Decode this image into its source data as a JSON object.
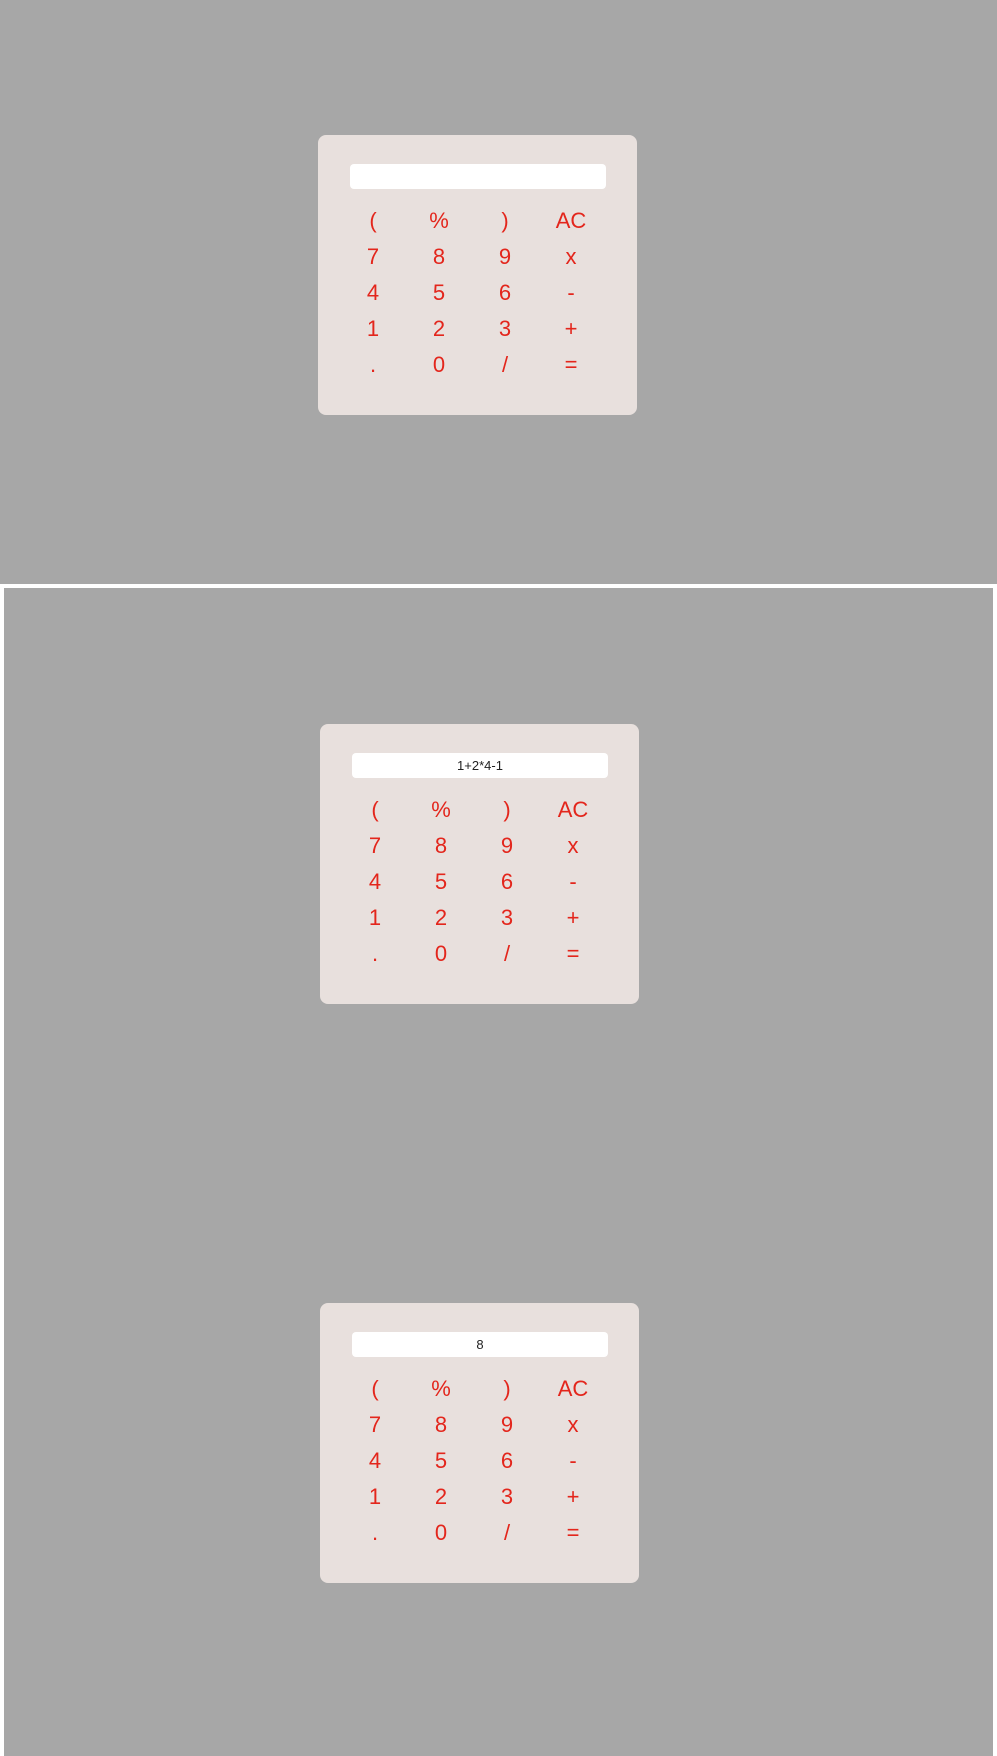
{
  "accent_color": "#e3261c",
  "states": [
    {
      "display": ""
    },
    {
      "display": "1+2*4-1"
    },
    {
      "display": "8"
    }
  ],
  "keys": [
    {
      "label": "(",
      "icon": null
    },
    {
      "label": "%",
      "icon": null
    },
    {
      "label": ")",
      "icon": null
    },
    {
      "label": "AC",
      "icon": null
    },
    {
      "label": "7",
      "icon": null
    },
    {
      "label": "8",
      "icon": null
    },
    {
      "label": "9",
      "icon": null
    },
    {
      "label": "x",
      "icon": null
    },
    {
      "label": "4",
      "icon": null
    },
    {
      "label": "5",
      "icon": null
    },
    {
      "label": "6",
      "icon": null
    },
    {
      "label": "-",
      "icon": null
    },
    {
      "label": "1",
      "icon": null
    },
    {
      "label": "2",
      "icon": null
    },
    {
      "label": "3",
      "icon": null
    },
    {
      "label": "+",
      "icon": null
    },
    {
      "label": ".",
      "icon": null
    },
    {
      "label": "0",
      "icon": null
    },
    {
      "label": "/",
      "icon": null
    },
    {
      "label": "=",
      "icon": null
    }
  ]
}
